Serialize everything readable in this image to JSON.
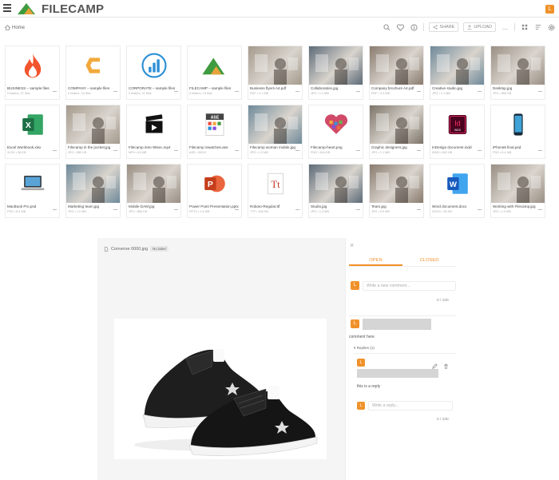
{
  "app": {
    "brand": "FILECAMP",
    "user_initial": "L"
  },
  "breadcrumb": {
    "home": "Home"
  },
  "toolbar": {
    "share_label": "SHARE",
    "upload_label": "UPLOAD",
    "more_label": "…"
  },
  "colors": {
    "accent": "#f0922b",
    "brand_green": "#4caf50",
    "dark_logo": "#555555"
  },
  "files": [
    {
      "name": "BUSINESS – sample files",
      "meta": "0 folders, 37 files",
      "thumb": "flame"
    },
    {
      "name": "COMPANY – sample files",
      "meta": "0 folders, 34 files",
      "thumb": "c-logo"
    },
    {
      "name": "CORPORATE – sample files",
      "meta": "0 folders, 37 files",
      "thumb": "chart-circle"
    },
    {
      "name": "FILECAMP – sample files",
      "meta": "0 folders, 19 files",
      "thumb": "filecamp-logo"
    },
    {
      "name": "Business flyers A4.pdf",
      "meta": "PDF • 2.1 MB",
      "thumb": "photo"
    },
    {
      "name": "Collaboration.jpg",
      "meta": "JPG • 1.2 MB",
      "thumb": "photo"
    },
    {
      "name": "Company brochure A4.pdf",
      "meta": "PDF • 3.4 MB",
      "thumb": "photo"
    },
    {
      "name": "Creative studio.jpg",
      "meta": "JPG • 1.1 MB",
      "thumb": "photo"
    },
    {
      "name": "Desktop.jpg",
      "meta": "JPG • 890 KB",
      "thumb": "photo"
    },
    {
      "name": "Excel Workbook.xlsx",
      "meta": "XLSX • 38 KB",
      "thumb": "excel"
    },
    {
      "name": "Filecamp in the pocket.jpg",
      "meta": "JPG • 980 KB",
      "thumb": "photo"
    },
    {
      "name": "Filecamp intro 90sec.mp4",
      "meta": "MP4 • 44 MB",
      "thumb": "clapper"
    },
    {
      "name": "Filecamp Swatches.ase",
      "meta": "ASE • 305 B",
      "thumb": "ase"
    },
    {
      "name": "Filecamp woman mobile.jpg",
      "meta": "JPG • 1.3 MB",
      "thumb": "photo"
    },
    {
      "name": "Filecamp-heart.png",
      "meta": "PNG • 644 KB",
      "thumb": "heart"
    },
    {
      "name": "Graphic designers.jpg",
      "meta": "JPG • 1.1 MB",
      "thumb": "photo"
    },
    {
      "name": "InDesign document.indd",
      "meta": "INDD • 842 KB",
      "thumb": "indd"
    },
    {
      "name": "iPhone8 final.psd",
      "meta": "PSD • 6.4 MB",
      "thumb": "phone"
    },
    {
      "name": "MacBook Pro.psd",
      "meta": "PSD • 8.4 MB",
      "thumb": "laptop"
    },
    {
      "name": "Marketing team.jpg",
      "meta": "JPG • 1.0 MB",
      "thumb": "photo"
    },
    {
      "name": "Mobile DAM.jpg",
      "meta": "JPG • 860 KB",
      "thumb": "photo"
    },
    {
      "name": "Power Point Presentation.pptx",
      "meta": "PPTX • 1.6 MB",
      "thumb": "ppt"
    },
    {
      "name": "Roboto-Regular.ttf",
      "meta": "TTF • 168 KB",
      "thumb": "font"
    },
    {
      "name": "Studio.jpg",
      "meta": "JPG • 1.3 MB",
      "thumb": "photo"
    },
    {
      "name": "Team.jpg",
      "meta": "JPG • 0.9 MB",
      "thumb": "photo"
    },
    {
      "name": "Word document.docx",
      "meta": "DOCX • 36 KB",
      "thumb": "word"
    },
    {
      "name": "Working with Filecamp.jpg",
      "meta": "JPG • 1.0 MB",
      "thumb": "photo"
    }
  ],
  "viewer": {
    "filename": "Converse 0000.jpg",
    "tag": "No label"
  },
  "comments": {
    "tab_open": "OPEN",
    "tab_closed": "CLOSED",
    "new_placeholder": "Write a new comment...",
    "new_count": "0 / 100",
    "comment_text": "comment here",
    "replies_label": "Replies (1)",
    "reply_text": "this is a reply",
    "reply_placeholder": "Write a reply...",
    "reply_count": "0 / 100"
  }
}
